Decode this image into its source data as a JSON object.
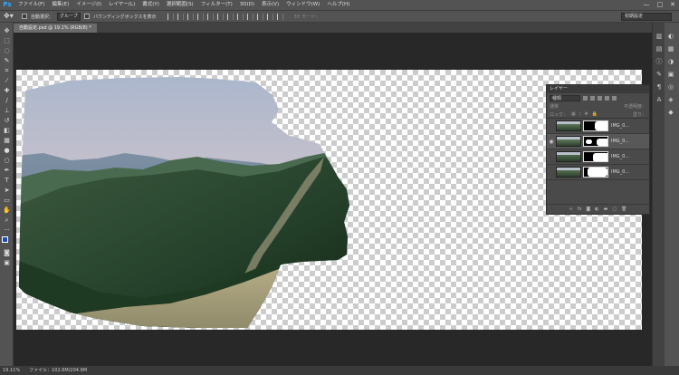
{
  "app": {
    "logo": "Ps"
  },
  "menus": [
    "ファイル(F)",
    "編集(E)",
    "イメージ(I)",
    "レイヤー(L)",
    "書式(Y)",
    "選択範囲(S)",
    "フィルター(T)",
    "3D(D)",
    "表示(V)",
    "ウィンドウ(W)",
    "ヘルプ(H)"
  ],
  "window_controls": [
    "—",
    "□",
    "✕"
  ],
  "options": {
    "auto_select_label": "自動選択：",
    "auto_select_value": "グループ",
    "bbox_label": "バウンディングボックスを表示",
    "mode_3d": "3D モード：",
    "workspace": "初期設定"
  },
  "document": {
    "tab_title": "自動設定.psd @ 19.1% (RGB/8) *"
  },
  "layers_panel": {
    "title": "レイヤー",
    "kind_filter": "種類",
    "blend_mode": "通常",
    "opacity_label": "不透明度：",
    "lock_label": "ロック：",
    "fill_label": "塗り：",
    "layers": [
      {
        "name": "IMG_0...",
        "visible": false,
        "selected": false
      },
      {
        "name": "IMG_0...",
        "visible": true,
        "selected": true
      },
      {
        "name": "IMG_0...",
        "visible": false,
        "selected": false
      },
      {
        "name": "IMG_0...",
        "visible": false,
        "selected": false
      }
    ],
    "footer_icons": [
      "link-icon",
      "fx-icon",
      "mask-icon",
      "adjust-icon",
      "folder-icon",
      "new-layer-icon",
      "trash-icon"
    ]
  },
  "status": {
    "zoom": "19.11%",
    "doc_info": "ファイル：102.6M/204.9M"
  },
  "colors": {
    "foreground": "#1a4db3",
    "background": "#ffffff"
  }
}
